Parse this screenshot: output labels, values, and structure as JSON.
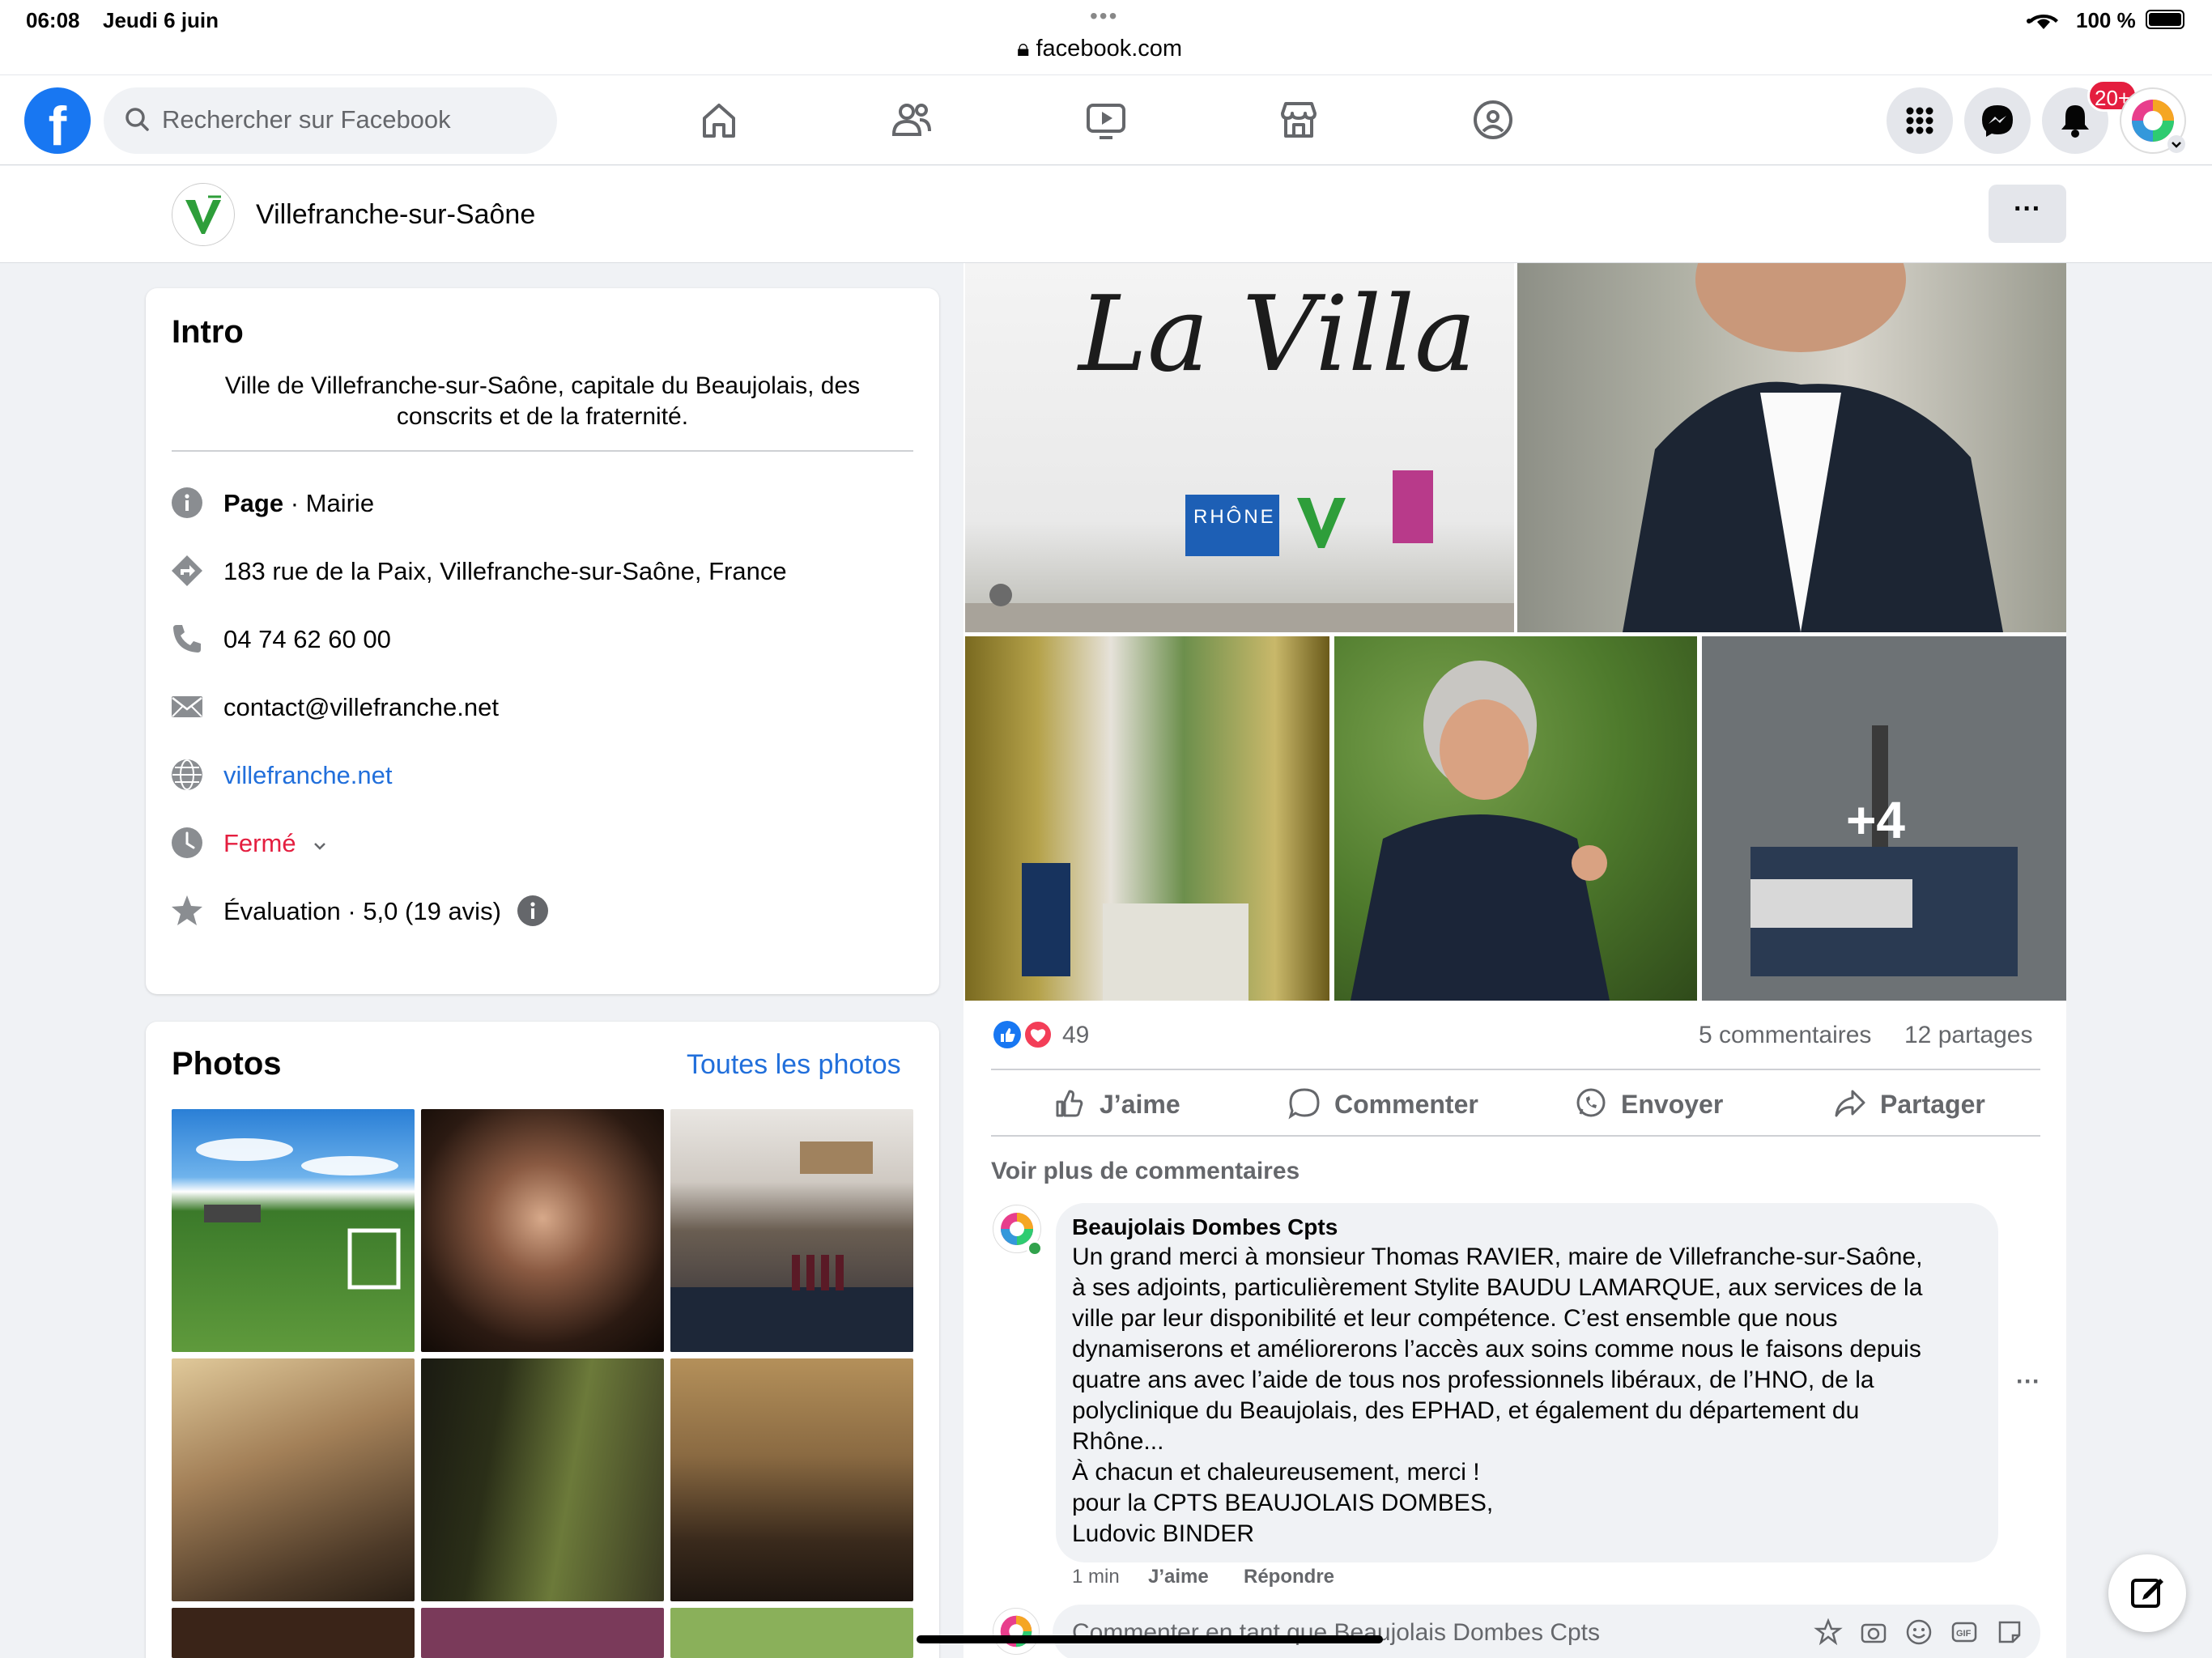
{
  "status_bar": {
    "time": "06:08",
    "date": "Jeudi 6 juin",
    "url": "facebook.com",
    "battery": "100 %"
  },
  "nav": {
    "search_placeholder": "Rechercher sur Facebook",
    "notifications_badge": "20+"
  },
  "page_header": {
    "name": "Villefranche-sur-Saône",
    "more": "···"
  },
  "intro": {
    "title": "Intro",
    "description_line1": "Ville de Villefranche-sur-Saône, capitale du Beaujolais, des",
    "description_line2": "conscrits et de la fraternité.",
    "category_label": "Page",
    "category_value": " · Mairie",
    "address": "183 rue de la Paix, Villefranche-sur-Saône, France",
    "phone": "04 74 62 60 00",
    "email": "contact@villefranche.net",
    "website": "villefranche.net",
    "hours_status": "Fermé",
    "rating": "Évaluation · 5,0 (19 avis)"
  },
  "photos": {
    "title": "Photos",
    "see_all": "Toutes les photos"
  },
  "post": {
    "image_sign_text": "La Villa",
    "image_logo_text": "RHÔNE",
    "more_photos": "+4",
    "reactions_count": "49",
    "comments_count": "5 commentaires",
    "shares_count": "12 partages",
    "actions": {
      "like": "J’aime",
      "comment": "Commenter",
      "send": "Envoyer",
      "share": "Partager"
    },
    "see_more_comments": "Voir plus de commentaires",
    "comment": {
      "author": "Beaujolais Dombes Cpts",
      "lines": [
        "Un grand merci à monsieur Thomas RAVIER, maire de Villefranche-sur-Saône,",
        "à ses adjoints, particulièrement Stylite BAUDU LAMARQUE, aux services de la",
        "ville par leur disponibilité et leur compétence. C’est ensemble que nous",
        "dynamiserons et améliorerons l’accès aux soins comme nous le faisons depuis",
        "quatre ans avec l’aide de tous nos professionnels libéraux, de l’HNO, de la",
        "polyclinique du Beaujolais, des EPHAD, et également du département du",
        "Rhône...",
        "À chacun et chaleureusement, merci !",
        "pour la CPTS BEAUJOLAIS DOMBES,",
        "Ludovic BINDER"
      ],
      "time": "1 min",
      "like": "J’aime",
      "reply": "Répondre"
    },
    "compose_placeholder": "Commenter en tant que Beaujolais Dombes Cpts"
  },
  "colors": {
    "facebook_blue": "#1877f2",
    "link_blue": "#216fdb",
    "closed_red": "#e41e3f",
    "background": "#f0f2f5"
  }
}
